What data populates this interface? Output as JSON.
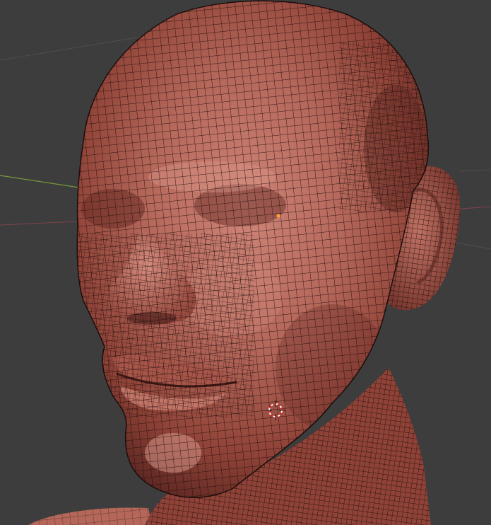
{
  "viewport": {
    "background_color": "#3d3d3d",
    "object": "head-mesh",
    "shading": "solid-with-wireframe",
    "mesh_base_color": "#a8584a",
    "mesh_highlight_color": "#d0877a",
    "mesh_shadow_color": "#5a2622",
    "wireframe_color": "#1b0d0b",
    "axis_x_color": "#a84a56",
    "axis_y_color": "#7a9a3a",
    "cursor_icon": "3d-cursor-icon",
    "selected_vertex_color": "#ffa533"
  }
}
